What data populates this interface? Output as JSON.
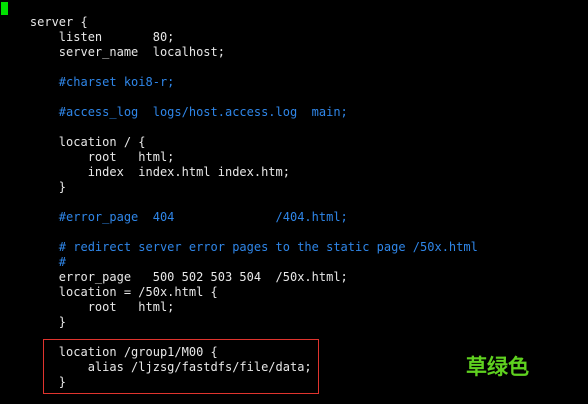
{
  "terminal": {
    "background": "#000000",
    "cursor_color": "#00e000",
    "text_color": "#e8e8e8",
    "comment_color": "#2f86e8",
    "lines": [
      {
        "text": "    server {",
        "kind": "code"
      },
      {
        "text": "        listen       80;",
        "kind": "code"
      },
      {
        "text": "        server_name  localhost;",
        "kind": "code"
      },
      {
        "text": "",
        "kind": "code"
      },
      {
        "text": "        #charset koi8-r;",
        "kind": "comment"
      },
      {
        "text": "",
        "kind": "code"
      },
      {
        "text": "        #access_log  logs/host.access.log  main;",
        "kind": "comment"
      },
      {
        "text": "",
        "kind": "code"
      },
      {
        "text": "        location / {",
        "kind": "code"
      },
      {
        "text": "            root   html;",
        "kind": "code"
      },
      {
        "text": "            index  index.html index.htm;",
        "kind": "code"
      },
      {
        "text": "        }",
        "kind": "code"
      },
      {
        "text": "",
        "kind": "code"
      },
      {
        "text": "        #error_page  404              /404.html;",
        "kind": "comment"
      },
      {
        "text": "",
        "kind": "code"
      },
      {
        "text": "        # redirect server error pages to the static page /50x.html",
        "kind": "comment"
      },
      {
        "text": "        #",
        "kind": "comment"
      },
      {
        "text": "        error_page   500 502 503 504  /50x.html;",
        "kind": "code"
      },
      {
        "text": "        location = /50x.html {",
        "kind": "code"
      },
      {
        "text": "            root   html;",
        "kind": "code"
      },
      {
        "text": "        }",
        "kind": "code"
      },
      {
        "text": "",
        "kind": "code"
      },
      {
        "text": "        location /group1/M00 {",
        "kind": "code"
      },
      {
        "text": "            alias /ljzsg/fastdfs/file/data;",
        "kind": "code"
      },
      {
        "text": "        }",
        "kind": "code"
      }
    ]
  },
  "highlight": {
    "border_color": "#e0342e"
  },
  "annotation": {
    "text": "草绿色",
    "color": "#5fd11f"
  }
}
